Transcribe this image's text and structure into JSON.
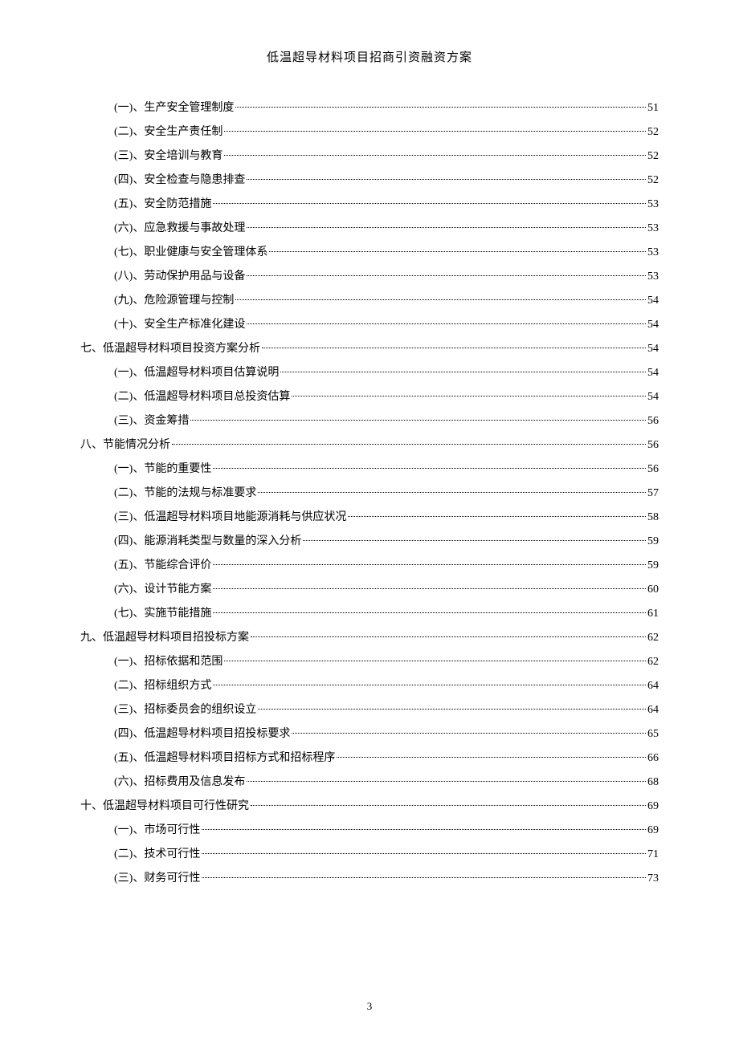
{
  "header": {
    "title": "低温超导材料项目招商引资融资方案"
  },
  "toc": {
    "items": [
      {
        "level": 2,
        "label": "(一)、生产安全管理制度",
        "page": "51"
      },
      {
        "level": 2,
        "label": "(二)、安全生产责任制",
        "page": "52"
      },
      {
        "level": 2,
        "label": "(三)、安全培训与教育",
        "page": "52"
      },
      {
        "level": 2,
        "label": "(四)、安全检查与隐患排查",
        "page": "52"
      },
      {
        "level": 2,
        "label": "(五)、安全防范措施",
        "page": "53"
      },
      {
        "level": 2,
        "label": "(六)、应急救援与事故处理",
        "page": "53"
      },
      {
        "level": 2,
        "label": "(七)、职业健康与安全管理体系",
        "page": "53"
      },
      {
        "level": 2,
        "label": "(八)、劳动保护用品与设备",
        "page": "53"
      },
      {
        "level": 2,
        "label": "(九)、危险源管理与控制",
        "page": "54"
      },
      {
        "level": 2,
        "label": "(十)、安全生产标准化建设",
        "page": "54"
      },
      {
        "level": 1,
        "label": "七、低温超导材料项目投资方案分析",
        "page": "54"
      },
      {
        "level": 2,
        "label": "(一)、低温超导材料项目估算说明",
        "page": "54"
      },
      {
        "level": 2,
        "label": "(二)、低温超导材料项目总投资估算",
        "page": "54"
      },
      {
        "level": 2,
        "label": "(三)、资金筹措",
        "page": "56"
      },
      {
        "level": 1,
        "label": "八、节能情况分析",
        "page": "56"
      },
      {
        "level": 2,
        "label": "(一)、节能的重要性",
        "page": "56"
      },
      {
        "level": 2,
        "label": "(二)、节能的法规与标准要求",
        "page": "57"
      },
      {
        "level": 2,
        "label": "(三)、低温超导材料项目地能源消耗与供应状况",
        "page": "58"
      },
      {
        "level": 2,
        "label": "(四)、能源消耗类型与数量的深入分析",
        "page": "59"
      },
      {
        "level": 2,
        "label": "(五)、节能综合评价",
        "page": "59"
      },
      {
        "level": 2,
        "label": "(六)、设计节能方案",
        "page": "60"
      },
      {
        "level": 2,
        "label": "(七)、实施节能措施",
        "page": "61"
      },
      {
        "level": 1,
        "label": "九、低温超导材料项目招投标方案",
        "page": "62"
      },
      {
        "level": 2,
        "label": "(一)、招标依据和范围",
        "page": "62"
      },
      {
        "level": 2,
        "label": "(二)、招标组织方式",
        "page": "64"
      },
      {
        "level": 2,
        "label": "(三)、招标委员会的组织设立",
        "page": "64"
      },
      {
        "level": 2,
        "label": "(四)、低温超导材料项目招投标要求",
        "page": "65"
      },
      {
        "level": 2,
        "label": "(五)、低温超导材料项目招标方式和招标程序",
        "page": "66"
      },
      {
        "level": 2,
        "label": "(六)、招标费用及信息发布",
        "page": "68"
      },
      {
        "level": 1,
        "label": "十、低温超导材料项目可行性研究",
        "page": "69"
      },
      {
        "level": 2,
        "label": "(一)、市场可行性",
        "page": "69"
      },
      {
        "level": 2,
        "label": "(二)、技术可行性",
        "page": "71"
      },
      {
        "level": 2,
        "label": "(三)、财务可行性",
        "page": "73"
      }
    ]
  },
  "footer": {
    "page_number": "3"
  }
}
